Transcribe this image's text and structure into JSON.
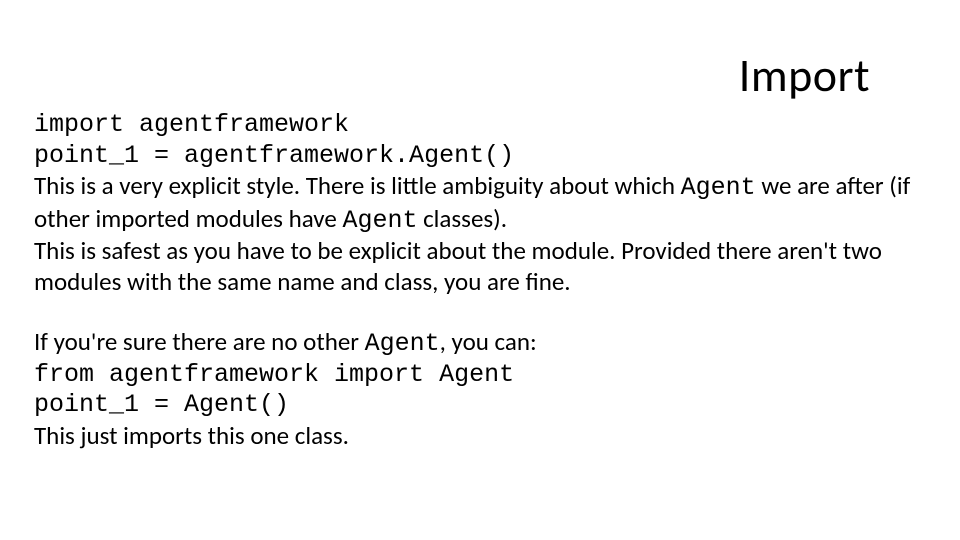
{
  "title": "Import",
  "block1": {
    "line1": "import agentframework",
    "line2": "point_1 = agentframework.Agent()",
    "explain1a": "This is a very explicit style. There is little ambiguity about which ",
    "explain1b": "Agent",
    "explain1c": " we are after (if other imported modules have ",
    "explain1d": "Agent",
    "explain1e": " classes).",
    "explain2": "This is safest as you have to be explicit about the module. Provided there aren't two modules with the same name and class, you are fine."
  },
  "block2": {
    "intro_a": "If you're sure there are no other ",
    "intro_b": "Agent",
    "intro_c": ", you can:",
    "line1": "from agentframework import Agent",
    "line2": "point_1 = Agent()",
    "outro": "This just imports this one class."
  }
}
